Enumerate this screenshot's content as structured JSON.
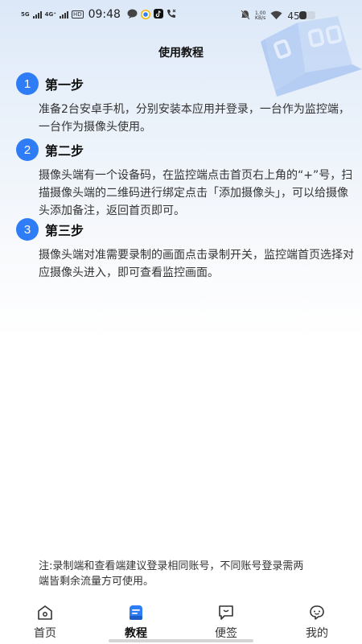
{
  "status_bar": {
    "net1": "5G",
    "net2": "4G⁺",
    "hd": "HD",
    "time": "09:48",
    "speed_value": "1.00",
    "speed_unit": "KB/s",
    "battery": "45%",
    "battery_level": 0.45
  },
  "page": {
    "title": "使用教程"
  },
  "steps": [
    {
      "number": "1",
      "title": "第一步",
      "text": "准备2台安卓手机，分别安装本应用并登录，一台作为监控端，一台作为摄像头使用。"
    },
    {
      "number": "2",
      "title": "第二步",
      "text": "摄像头端有一个设备码，在监控端点击首页右上角的“+”号，扫描摄像头端的二维码进行绑定点击「添加摄像头」，可以给摄像头添加备注，返回首页即可。"
    },
    {
      "number": "3",
      "title": "第三步",
      "text": "摄像头端对准需要录制的画面点击录制开关，监控端首页选择对应摄像头进入，即可查看监控画面。"
    }
  ],
  "note": "注:录制端和查看端建议登录相同账号，不同账号登录需两端皆剩余流量方可使用。",
  "tabs": [
    {
      "label": "首页",
      "icon": "home-icon"
    },
    {
      "label": "教程",
      "icon": "tutorial-icon"
    },
    {
      "label": "便签",
      "icon": "note-icon"
    },
    {
      "label": "我的",
      "icon": "profile-icon"
    }
  ],
  "colors": {
    "accent": "#2f7df6",
    "decoration": "#8fb3ee"
  }
}
